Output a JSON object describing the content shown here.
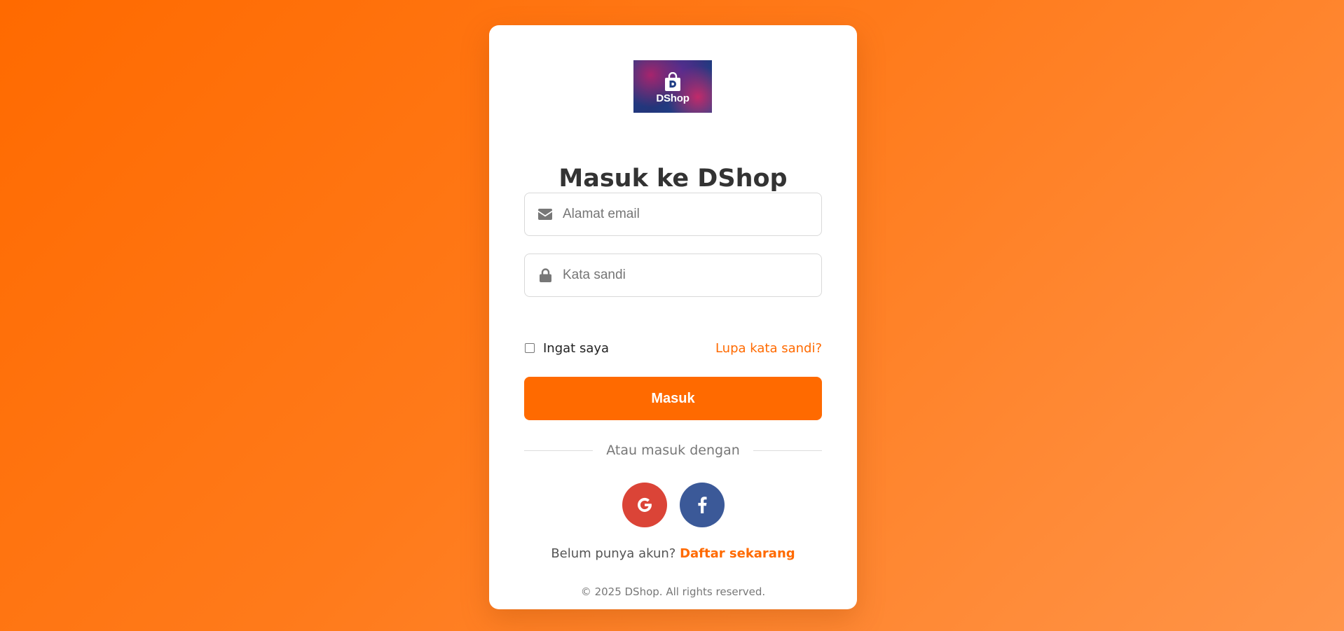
{
  "logo": {
    "text": "DShop",
    "icon": "shopping-bag-icon"
  },
  "login": {
    "title": "Masuk ke DShop",
    "email_placeholder": "Alamat email",
    "email_icon": "envelope-icon",
    "password_placeholder": "Kata sandi",
    "password_icon": "lock-icon",
    "remember_label": "Ingat saya",
    "remember_checked": false,
    "forgot_label": "Lupa kata sandi?",
    "submit_label": "Masuk",
    "divider_text": "Atau masuk dengan",
    "social": [
      {
        "name": "google",
        "icon": "google-icon",
        "color": "#db4437"
      },
      {
        "name": "facebook",
        "icon": "facebook-icon",
        "color": "#3b5998"
      }
    ],
    "signup_prompt": "Belum punya akun?",
    "signup_link": "Daftar sekarang",
    "copyright": "© 2025 DShop. All rights reserved."
  },
  "colors": {
    "accent": "#ff6a00",
    "background_start": "#ff6a00",
    "background_end": "#ff9448",
    "text_dark": "#333333",
    "text_muted": "#777777"
  }
}
